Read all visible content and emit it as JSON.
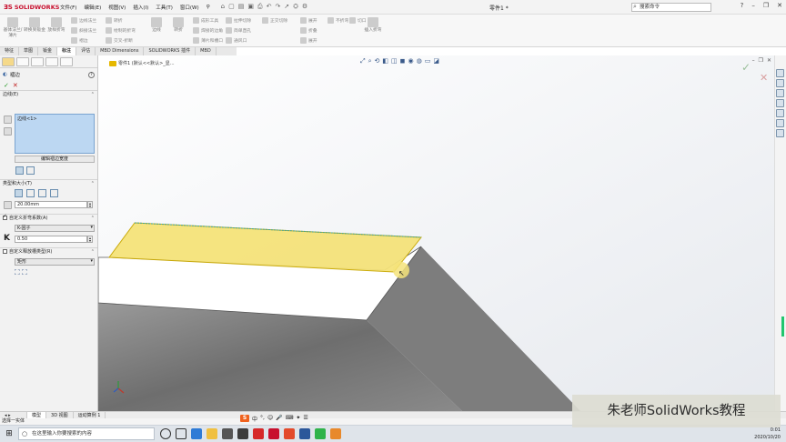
{
  "app": {
    "logo_text": "SOLIDWORKS",
    "doc_title": "零件1 *",
    "search_placeholder": "搜索命令"
  },
  "menu": [
    "文件(F)",
    "编辑(E)",
    "视图(V)",
    "插入(I)",
    "工具(T)",
    "窗口(W)"
  ],
  "ribbon": {
    "big_buttons": [
      "基体法兰/薄片",
      "转换到钣金",
      "放样折弯",
      "边线",
      "转折",
      "折叠"
    ],
    "col1": [
      "边线法兰",
      "斜接法兰",
      "褶边"
    ],
    "col2": [
      "绘制的折弯",
      "交叉-折断"
    ],
    "col3": [
      "转折"
    ],
    "col4": [
      "成形工具",
      "拉伸切除",
      "简单直孔"
    ],
    "col5": [
      "通风口",
      "焊接的边角",
      "薄片和槽口"
    ],
    "col6": [
      "正交切除",
      "展开",
      "折叠"
    ],
    "col7": [
      "不折弯",
      "展开"
    ],
    "col8": [
      "插入折弯",
      "切口"
    ]
  },
  "tabs": [
    "特征",
    "草图",
    "钣金",
    "标注",
    "评估",
    "MBD Dimensions",
    "SOLIDWORKS 插件",
    "MBD"
  ],
  "active_tab": "钣金",
  "panel": {
    "title": "褶边",
    "sections": {
      "edges": "边线(E)",
      "selection_item": "边线<1>",
      "edit_width_button": "编辑褶边宽度",
      "type_size": "类型和大小(T)",
      "length_value": "20.00mm",
      "custom_bend": "自定义折弯系数(A)",
      "k_factor_type": "K-因子",
      "k_label": "K",
      "k_value": "0.50",
      "custom_relief": "自定义释放槽类型(R)",
      "relief_type": "矩形"
    }
  },
  "viewport": {
    "breadcrumb": "零件1 (默认<<默认>_显..."
  },
  "bottom_tabs": [
    "模型",
    "3D 视图",
    "运动算例 1"
  ],
  "status_text": "选择一实体",
  "taskbar": {
    "search_placeholder": "在这里输入你要搜索的内容",
    "time": "0:01",
    "date": "2020/10/20"
  },
  "watermark": "朱老师SolidWorks教程",
  "colors": {
    "highlight_yellow": "#f5e37a",
    "selection_blue": "#bcd7f2",
    "part_gray": "#7a7a7a",
    "brand_red": "#c8102e"
  }
}
